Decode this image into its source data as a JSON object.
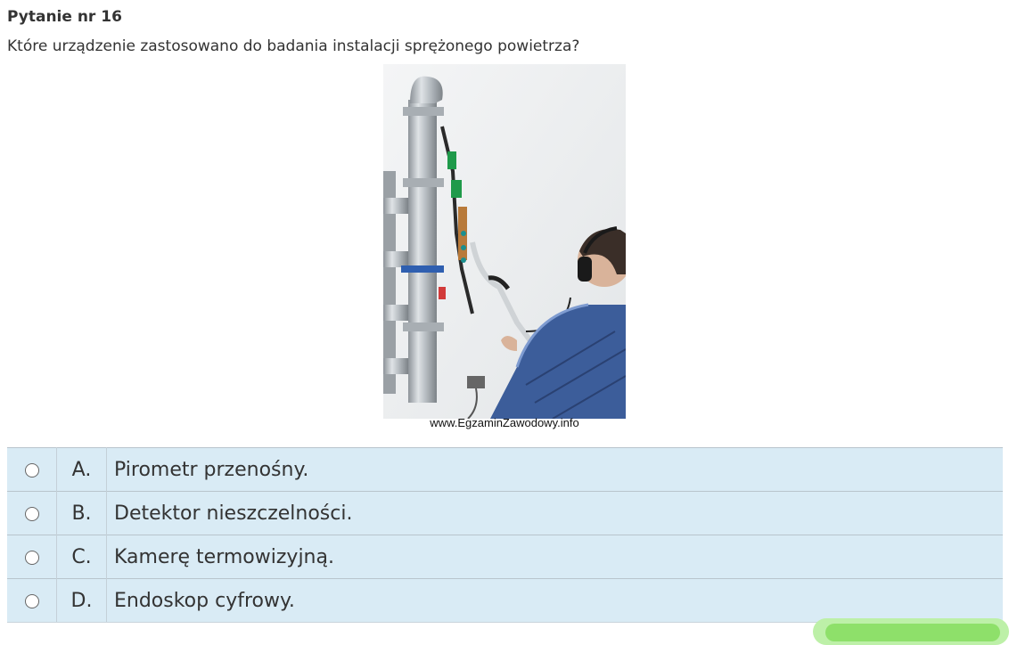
{
  "question": {
    "number_label": "Pytanie nr 16",
    "text": "Które urządzenie zastosowano do badania instalacji sprężonego powietrza?"
  },
  "image": {
    "watermark": "www.EgzaminZawodowy.info"
  },
  "answers": [
    {
      "letter": "A.",
      "text": "Pirometr przenośny."
    },
    {
      "letter": "B.",
      "text": "Detektor nieszczelności."
    },
    {
      "letter": "C.",
      "text": "Kamerę termowizyjną."
    },
    {
      "letter": "D.",
      "text": "Endoskop cyfrowy."
    }
  ],
  "colors": {
    "answer_background": "#d9ebf5",
    "text": "#333333"
  }
}
